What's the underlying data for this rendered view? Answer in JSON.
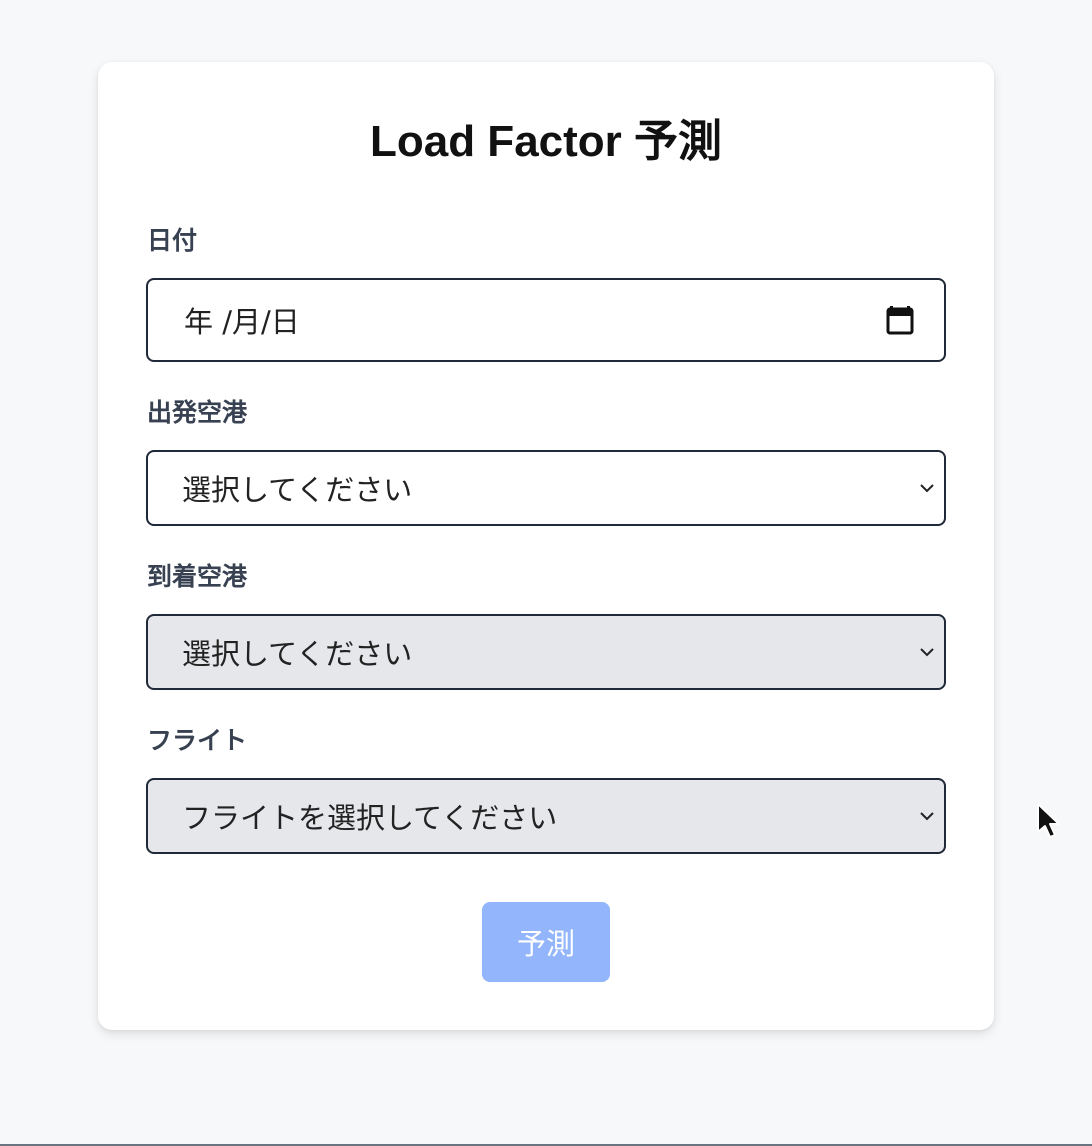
{
  "form": {
    "title": "Load Factor 予測",
    "date": {
      "label": "日付",
      "value": "年 /月/日",
      "icon": "calendar-icon"
    },
    "departure": {
      "label": "出発空港",
      "selected": "選択してください"
    },
    "arrival": {
      "label": "到着空港",
      "selected": "選択してください",
      "disabled": true
    },
    "flight": {
      "label": "フライト",
      "selected": "フライトを選択してください",
      "disabled": true
    },
    "submit_label": "予測",
    "submit_disabled": true
  },
  "colors": {
    "card_background": "#ffffff",
    "disabled_select_background": "#e5e7eb",
    "submit_disabled_background": "#93b5fb",
    "label_text": "#374151"
  }
}
